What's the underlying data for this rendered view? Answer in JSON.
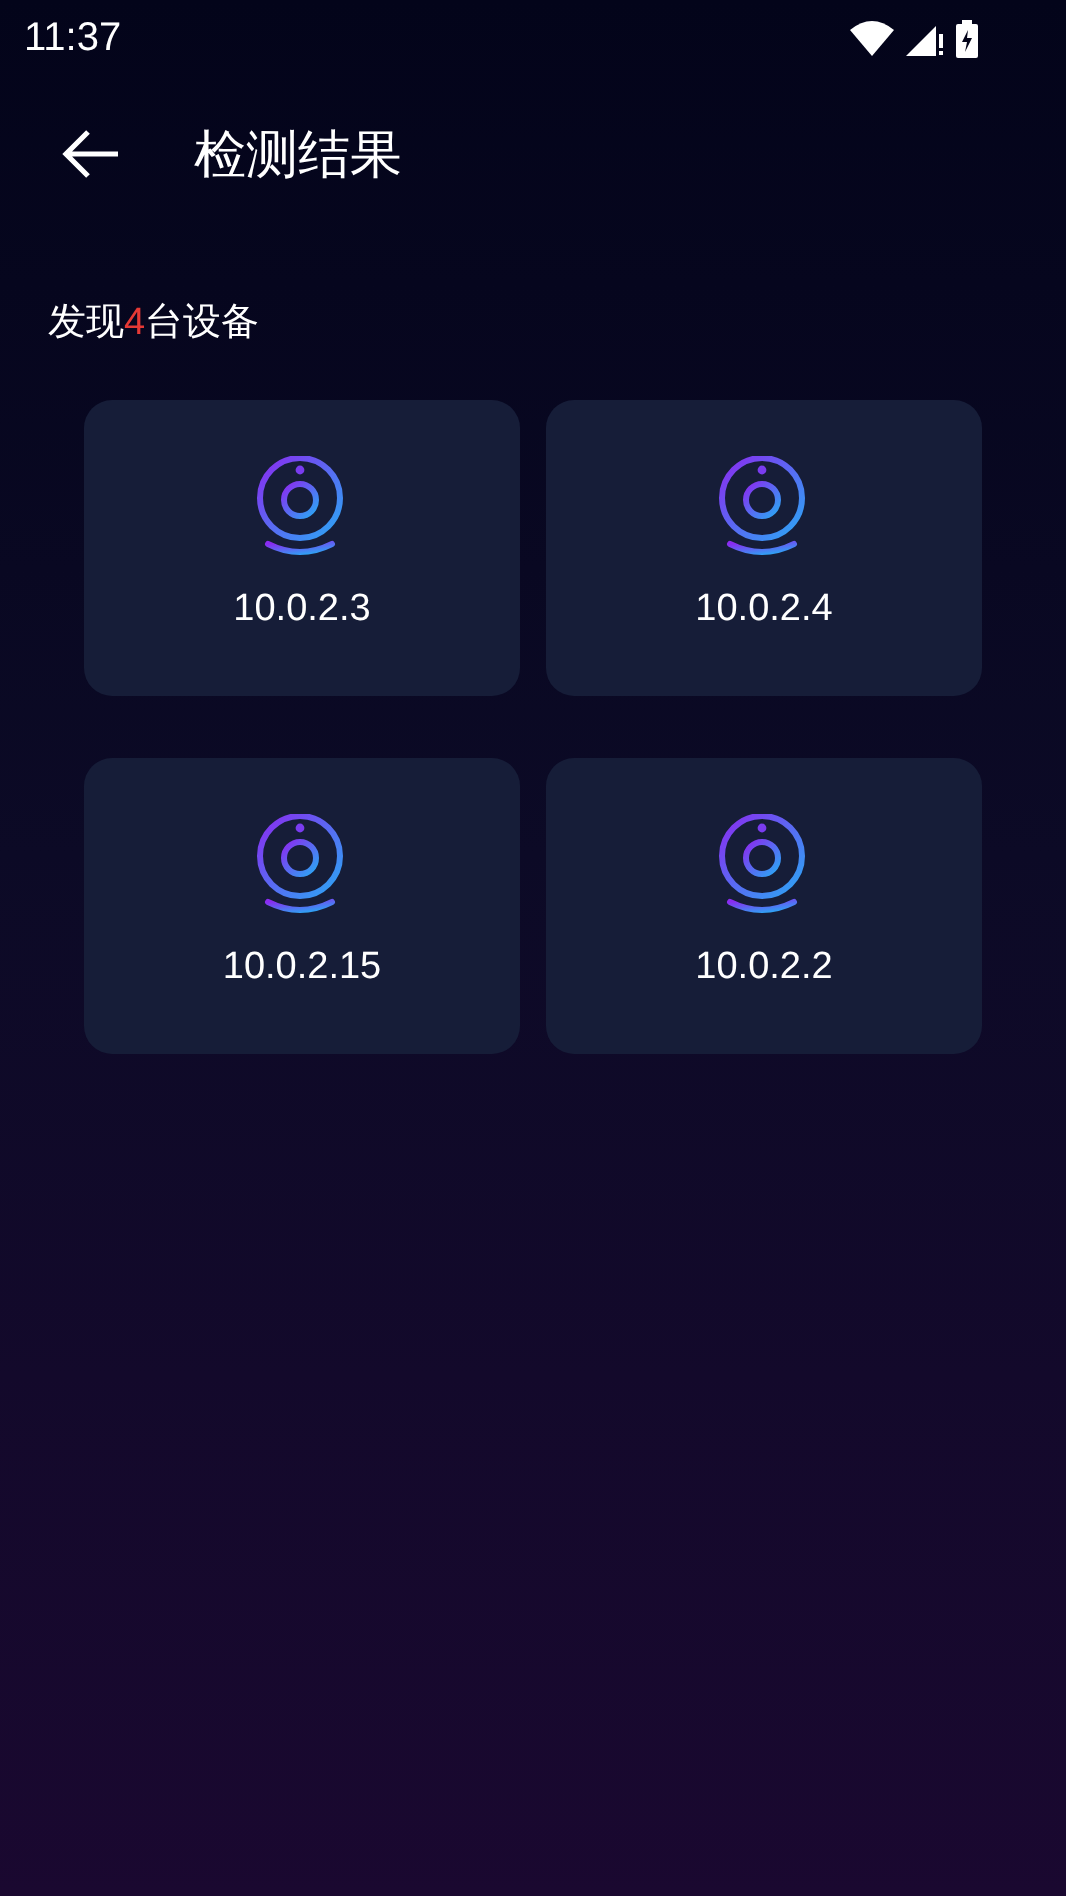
{
  "status_bar": {
    "time": "11:37"
  },
  "header": {
    "title": "检测结果"
  },
  "summary": {
    "prefix": "发现",
    "count": "4",
    "suffix": "台设备"
  },
  "devices": [
    {
      "address": "10.0.2.3"
    },
    {
      "address": "10.0.2.4"
    },
    {
      "address": "10.0.2.15"
    },
    {
      "address": "10.0.2.2"
    }
  ]
}
